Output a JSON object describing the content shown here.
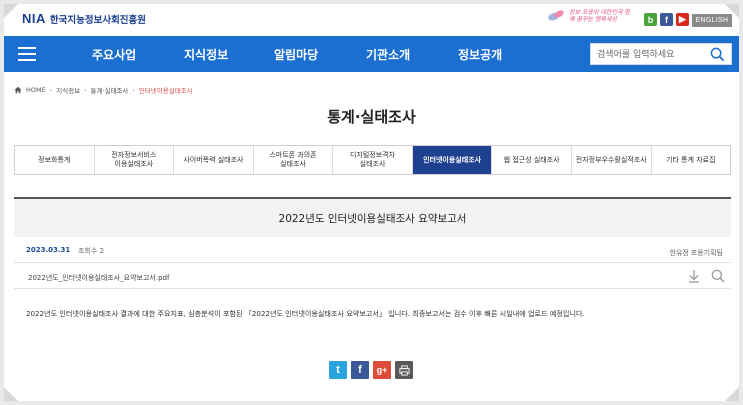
{
  "header": {
    "logo_mark": "NIA",
    "logo_text": "한국지능정보사회진흥원",
    "slogan": "정보 포용의 대한민국 함께 꿈꾸는 행복세상",
    "english_label": "ENGLISH",
    "sns": {
      "blog": "b",
      "facebook": "f",
      "youtube": "▶"
    }
  },
  "gnb": {
    "items": [
      "주요사업",
      "지식정보",
      "알림마당",
      "기관소개",
      "정보공개"
    ],
    "search_placeholder": "검색어를 입력하세요"
  },
  "breadcrumb": {
    "home": "HOME",
    "level1": "지식정보",
    "level2": "통계·실태조사",
    "current": "인터넷이용실태조사",
    "sep": "›"
  },
  "page_title": "통계·실태조사",
  "tabs": [
    {
      "label": "정보화통계",
      "active": false
    },
    {
      "label": "전자정보서비스\n이용실태조사",
      "active": false
    },
    {
      "label": "사이버폭력 실태조사",
      "active": false
    },
    {
      "label": "스마트폰 과의존\n실태조사",
      "active": false
    },
    {
      "label": "디지털정보격차\n실태조사",
      "active": false
    },
    {
      "label": "인터넷이용실태조사",
      "active": true
    },
    {
      "label": "웹 접근성 실태조사",
      "active": false
    },
    {
      "label": "전자정부우수활실적조사",
      "active": false
    },
    {
      "label": "기타 통계 자료집",
      "active": false
    }
  ],
  "post": {
    "title": "2022년도 인터넷이용실태조사 요약보고서",
    "date": "2023.03.31",
    "views": "조회수 2",
    "author": "한유정",
    "dept": "포용기획팀",
    "attachment": "2022년도_인터넷이용실태조사_요약보고서.pdf",
    "body": "2022년도 인터넷이용실태조사 결과에 대한 주요지표, 심층분석이 포함된 「2022년도 인터넷이용실태조사 요약보고서」 입니다. 최종보고서는 검수 이후 빠른 시일내에 업로드 예정입니다."
  },
  "share": {
    "twitter": "t",
    "facebook": "f",
    "google": "g+"
  },
  "colors": {
    "gnb_blue": "#1a6fd1",
    "active_tab": "#1f3f8f",
    "date_blue": "#1b4f9c",
    "breadcrumb_current": "#d9534f"
  }
}
